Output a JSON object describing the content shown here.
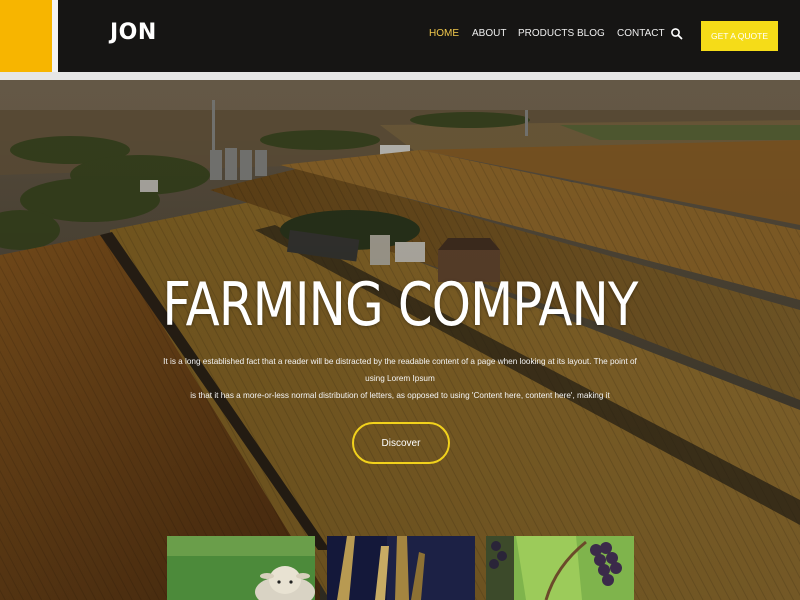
{
  "brand": {
    "name": "JON",
    "accent_color": "#f7b500"
  },
  "nav": {
    "items": [
      {
        "label": "HOME",
        "active": true
      },
      {
        "label": "ABOUT",
        "active": false
      },
      {
        "label": "PRODUCTS",
        "active": false
      },
      {
        "label": "BLOG",
        "active": false
      },
      {
        "label": "CONTACT",
        "active": false
      }
    ],
    "search_icon": "search-icon",
    "cta_label": "GET A QUOTE"
  },
  "hero": {
    "title": "FARMING COMPANY",
    "description_line1": "It is a long established fact that a reader will be distracted by the readable content of a page when looking at its layout. The point of using Lorem Ipsum",
    "description_line2": "is that it has a more-or-less normal distribution of letters, as opposed to using 'Content here, content here', making it",
    "button_label": "Discover",
    "button_color": "#f2d21c"
  },
  "gallery": {
    "items": [
      {
        "subject": "sheep"
      },
      {
        "subject": "wheat"
      },
      {
        "subject": "grapes"
      }
    ]
  }
}
